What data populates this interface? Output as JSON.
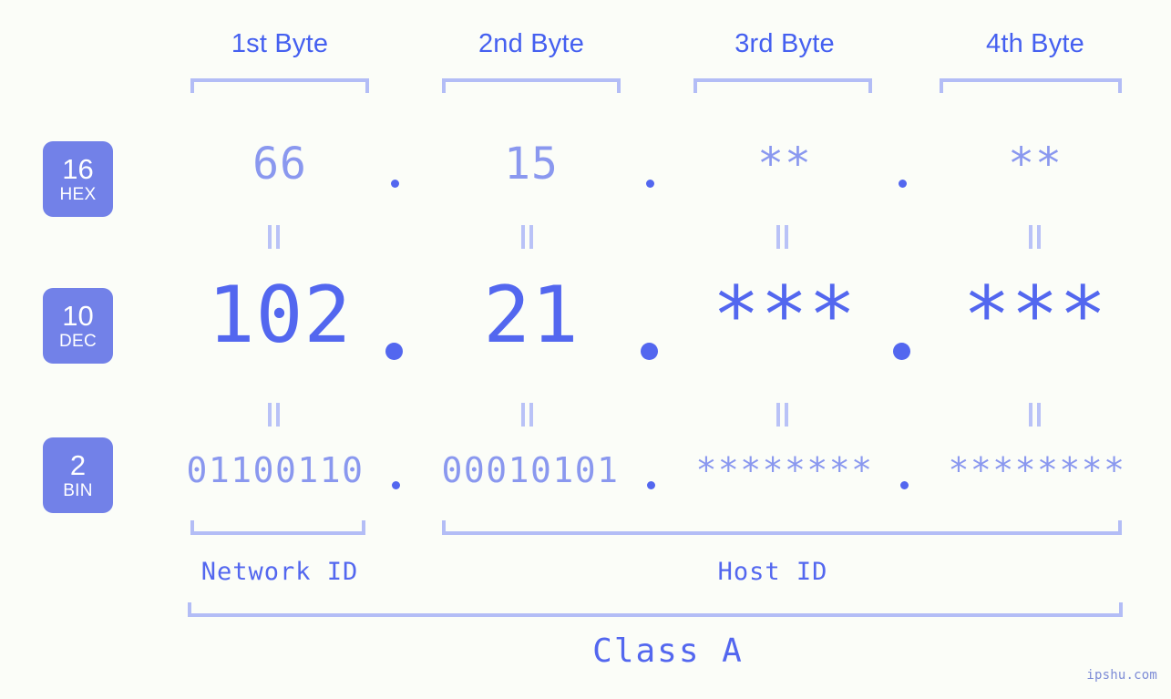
{
  "meta": {
    "watermark": "ipshu.com",
    "bg_color": "#fbfdf8",
    "accent_strong": "#5367ef",
    "accent_light": "#8a98ef",
    "accent_bracket": "#b3bdf6",
    "badge_bg": "#7281e8",
    "header_color": "#4560f0"
  },
  "headers": {
    "byte1": "1st Byte",
    "byte2": "2nd Byte",
    "byte3": "3rd Byte",
    "byte4": "4th Byte"
  },
  "badges": [
    {
      "num": "16",
      "abbr": "HEX"
    },
    {
      "num": "10",
      "abbr": "DEC"
    },
    {
      "num": "2",
      "abbr": "BIN"
    }
  ],
  "rows": {
    "hex": {
      "base": "16",
      "name": "HEX",
      "values": [
        "66",
        "15",
        "**",
        "**"
      ]
    },
    "dec": {
      "base": "10",
      "name": "DEC",
      "values": [
        "102",
        "21",
        "***",
        "***"
      ]
    },
    "bin": {
      "base": "2",
      "name": "BIN",
      "values": [
        "01100110",
        "00010101",
        "********",
        "********"
      ]
    }
  },
  "separators": {
    "dot": ".",
    "equals": "||"
  },
  "footer": {
    "network_id": "Network ID",
    "host_id": "Host ID",
    "class": "Class A"
  }
}
